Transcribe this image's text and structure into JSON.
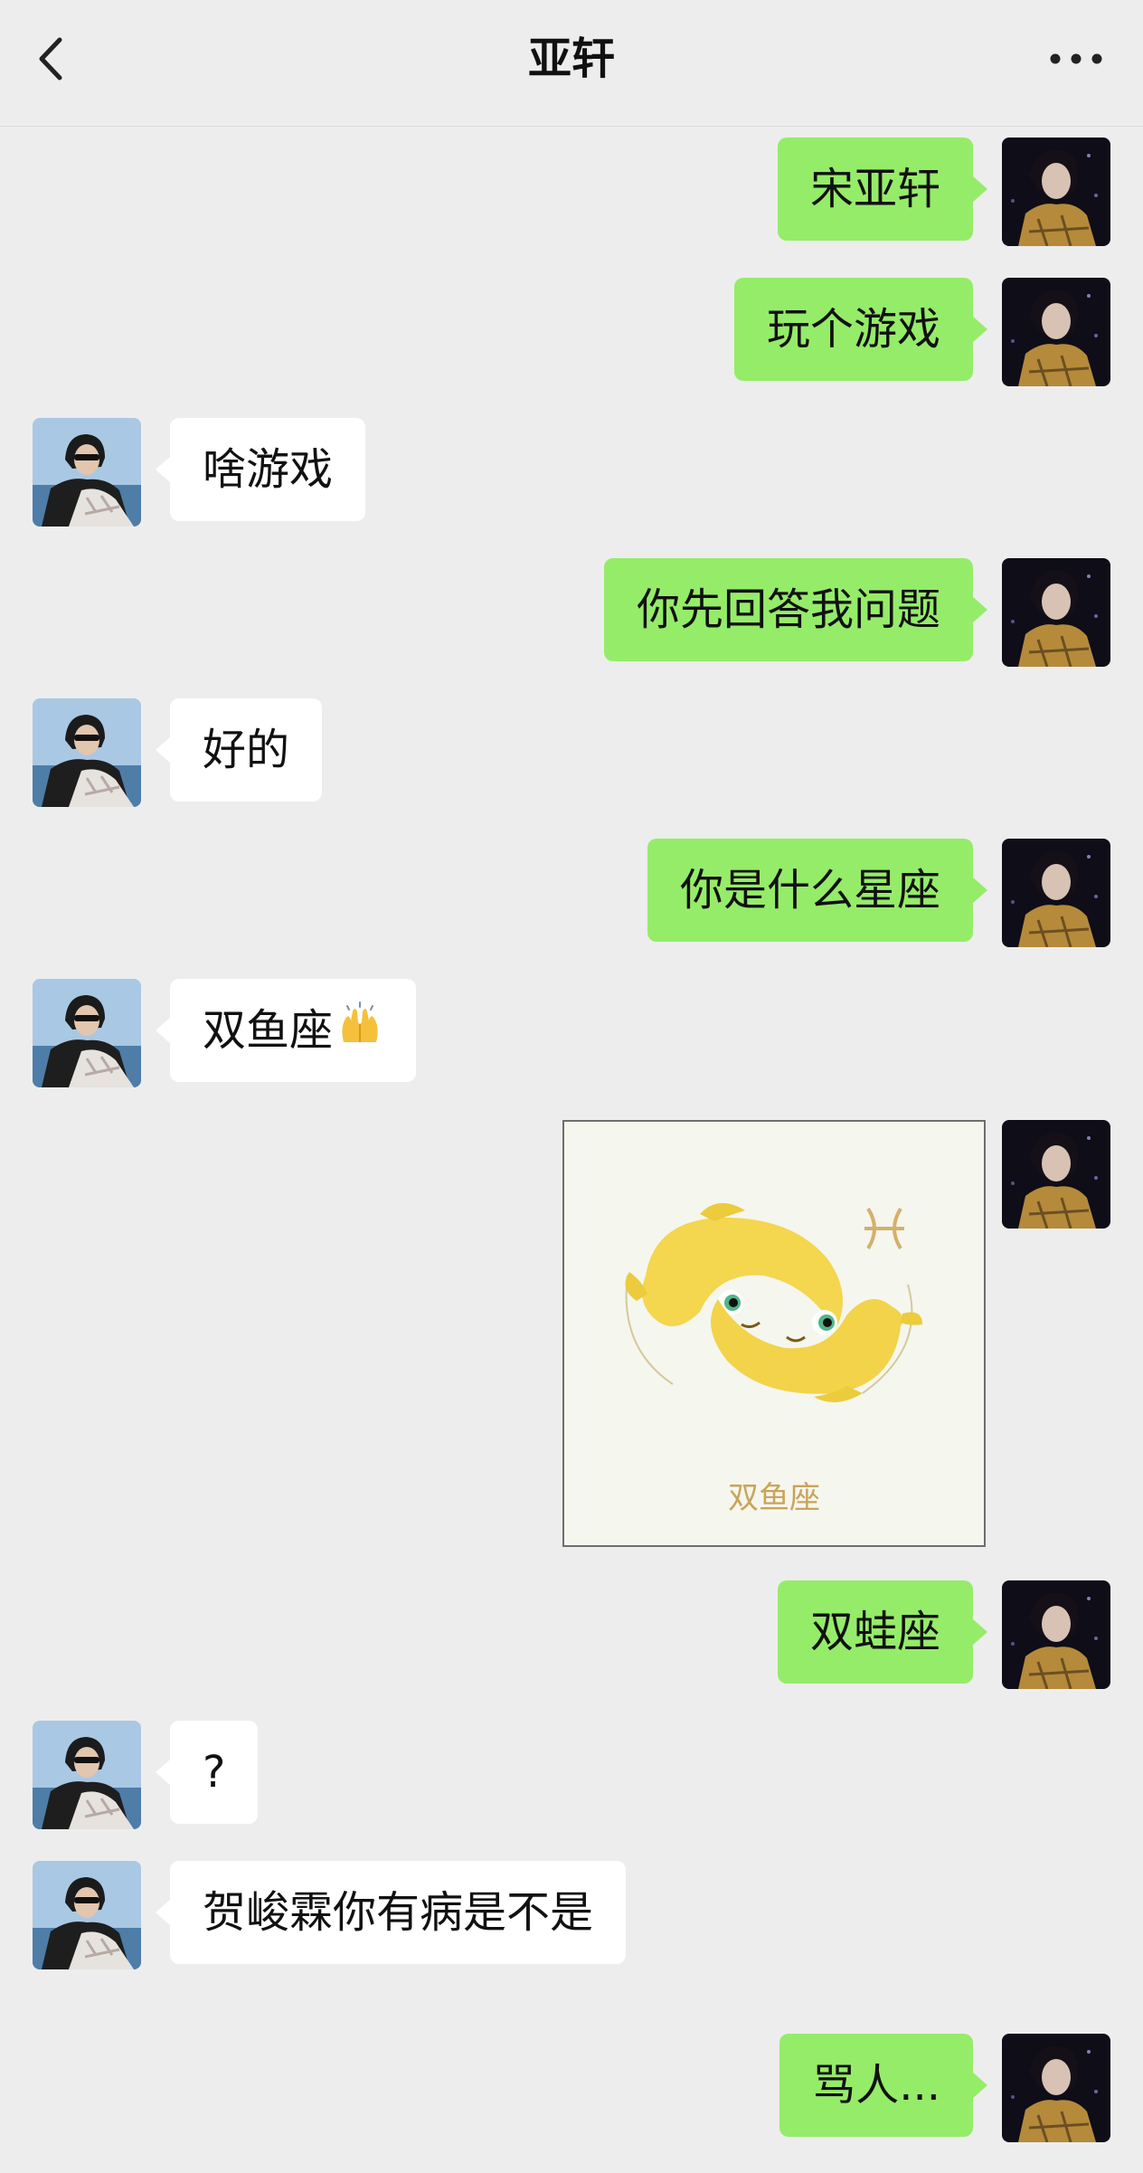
{
  "header": {
    "title": "亚轩"
  },
  "messages": [
    {
      "from": "me",
      "text": "宋亚轩"
    },
    {
      "from": "me",
      "text": "玩个游戏"
    },
    {
      "from": "them",
      "text": "啥游戏"
    },
    {
      "from": "me",
      "text": "你先回答我问题"
    },
    {
      "from": "them",
      "text": "好的"
    },
    {
      "from": "me",
      "text": "你是什么星座"
    },
    {
      "from": "them",
      "text": "双鱼座"
    },
    {
      "from": "me",
      "type": "image",
      "caption": "双鱼座"
    },
    {
      "from": "me",
      "text": "双蛙座"
    },
    {
      "from": "them",
      "text": "?"
    },
    {
      "from": "them",
      "text": "贺峻霖你有病是不是"
    },
    {
      "from": "me",
      "text": "骂人..."
    }
  ],
  "colors": {
    "background": "#ededed",
    "my_bubble": "#95ec69",
    "their_bubble": "#ffffff",
    "image_caption": "#c9a45a"
  },
  "icons": {
    "back": "chevron-left-icon",
    "more": "ellipsis-icon",
    "emoji_after_pisces": "raising-hands-emoji"
  }
}
